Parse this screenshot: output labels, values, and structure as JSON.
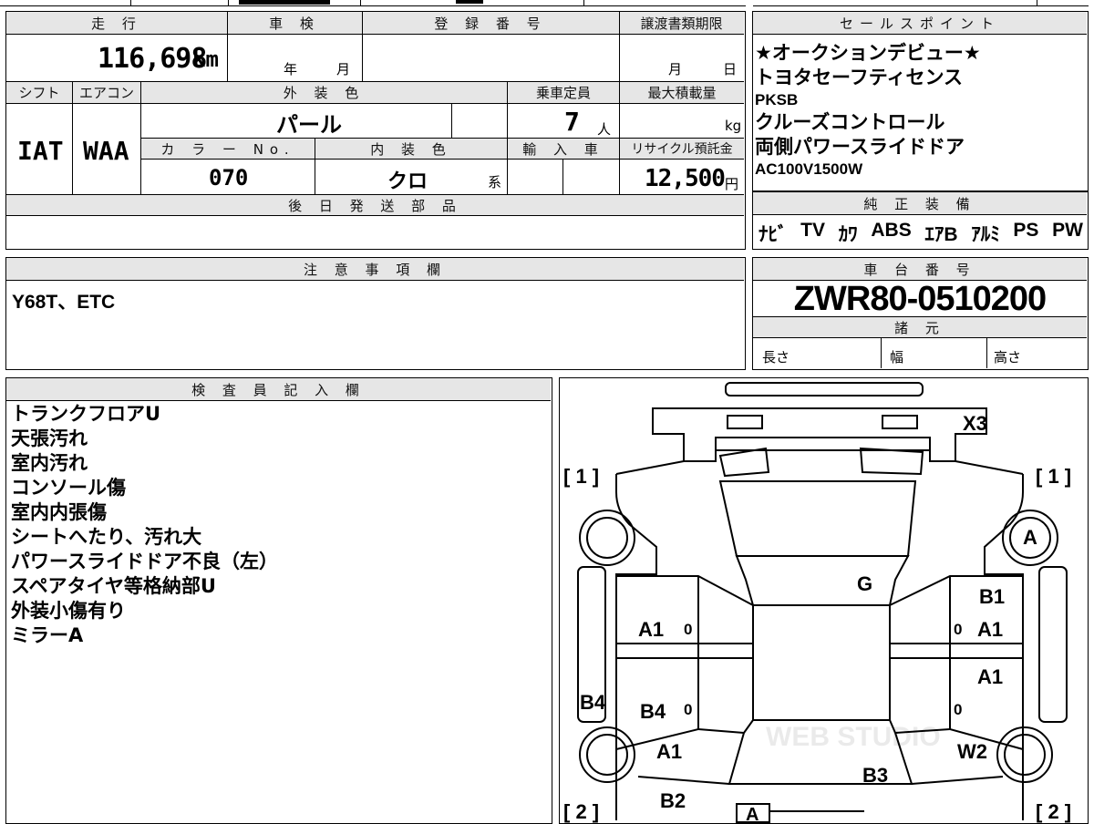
{
  "main": {
    "headers": {
      "mileage": "走 行",
      "inspection": "車 検",
      "registration": "登 録 番 号",
      "transfer_deadline": "譲渡書類期限",
      "shift": "シフト",
      "aircon": "エアコン",
      "exterior_color": "外 装 色",
      "capacity": "乗車定員",
      "max_load": "最大積載量",
      "color_no": "カ ラ ー No.",
      "interior_color": "内 装 色",
      "import": "輸 入 車",
      "recycle": "リサイクル預託金",
      "later_parts": "後 日 発 送 部 品"
    },
    "mileage_value": "116,698",
    "mileage_unit": "km",
    "inspection_year": "年",
    "inspection_month": "月",
    "deadline_month": "月",
    "deadline_day": "日",
    "shift_value": "IAT",
    "aircon_value": "WAA",
    "exterior_color_value": "パール",
    "capacity_value": "7",
    "capacity_unit": "人",
    "max_load_unit": "kg",
    "color_no_value": "070",
    "interior_color_value": "クロ",
    "interior_color_suffix": "系",
    "recycle_value": "12,500",
    "recycle_unit": "円"
  },
  "sales_points": {
    "header": "セールスポイント",
    "lines": [
      {
        "text": "★オークションデビュー★",
        "size": "large"
      },
      {
        "text": "トヨタセーフティセンス",
        "size": "large"
      },
      {
        "text": "PKSB",
        "size": "small"
      },
      {
        "text": "クルーズコントロール",
        "size": "large"
      },
      {
        "text": "両側パワースライドドア",
        "size": "large"
      },
      {
        "text": "AC100V1500W",
        "size": "small"
      }
    ]
  },
  "equipment": {
    "header": "純 正 装 備",
    "items": [
      "ﾅﾋﾞ",
      "TV",
      "ｶﾜ",
      "ABS",
      "ｴｱB",
      "ｱﾙﾐ",
      "PS",
      "PW"
    ]
  },
  "notes": {
    "header": "注 意 事 項 欄",
    "text": "Y68T、ETC"
  },
  "chassis": {
    "header": "車 台 番 号",
    "value": "ZWR80-0510200",
    "spec_header": "諸 元",
    "length_label": "長さ",
    "width_label": "幅",
    "height_label": "高さ"
  },
  "inspector": {
    "header": "検 査 員 記 入 欄",
    "lines": [
      "トランクフロアU",
      "天張汚れ",
      "室内汚れ",
      "コンソール傷",
      "室内内張傷",
      "シートへたり、汚れ大",
      "パワースライドドア不良（左）",
      "スペアタイヤ等格納部U",
      "外装小傷有り",
      "ミラーA"
    ]
  },
  "diagram": {
    "watermark": "WEB STUDIO",
    "marks": {
      "x3": "X3",
      "bracket_1_left": "[ 1 ]",
      "bracket_1_right": "[ 1 ]",
      "bracket_2_left": "[ 2 ]",
      "bracket_2_right": "[ 2 ]",
      "a_right_wheel": "A",
      "g": "G",
      "b1": "B1",
      "a1_left_front": "A1",
      "a1_right_front": "A1",
      "a1_right_rear": "A1",
      "b4_left_edge": "B4",
      "b4_left_door": "B4",
      "a1_left_lower": "A1",
      "w2": "W2",
      "b3": "B3",
      "b2": "B2",
      "a_bottom": "A",
      "zero": "0"
    }
  }
}
